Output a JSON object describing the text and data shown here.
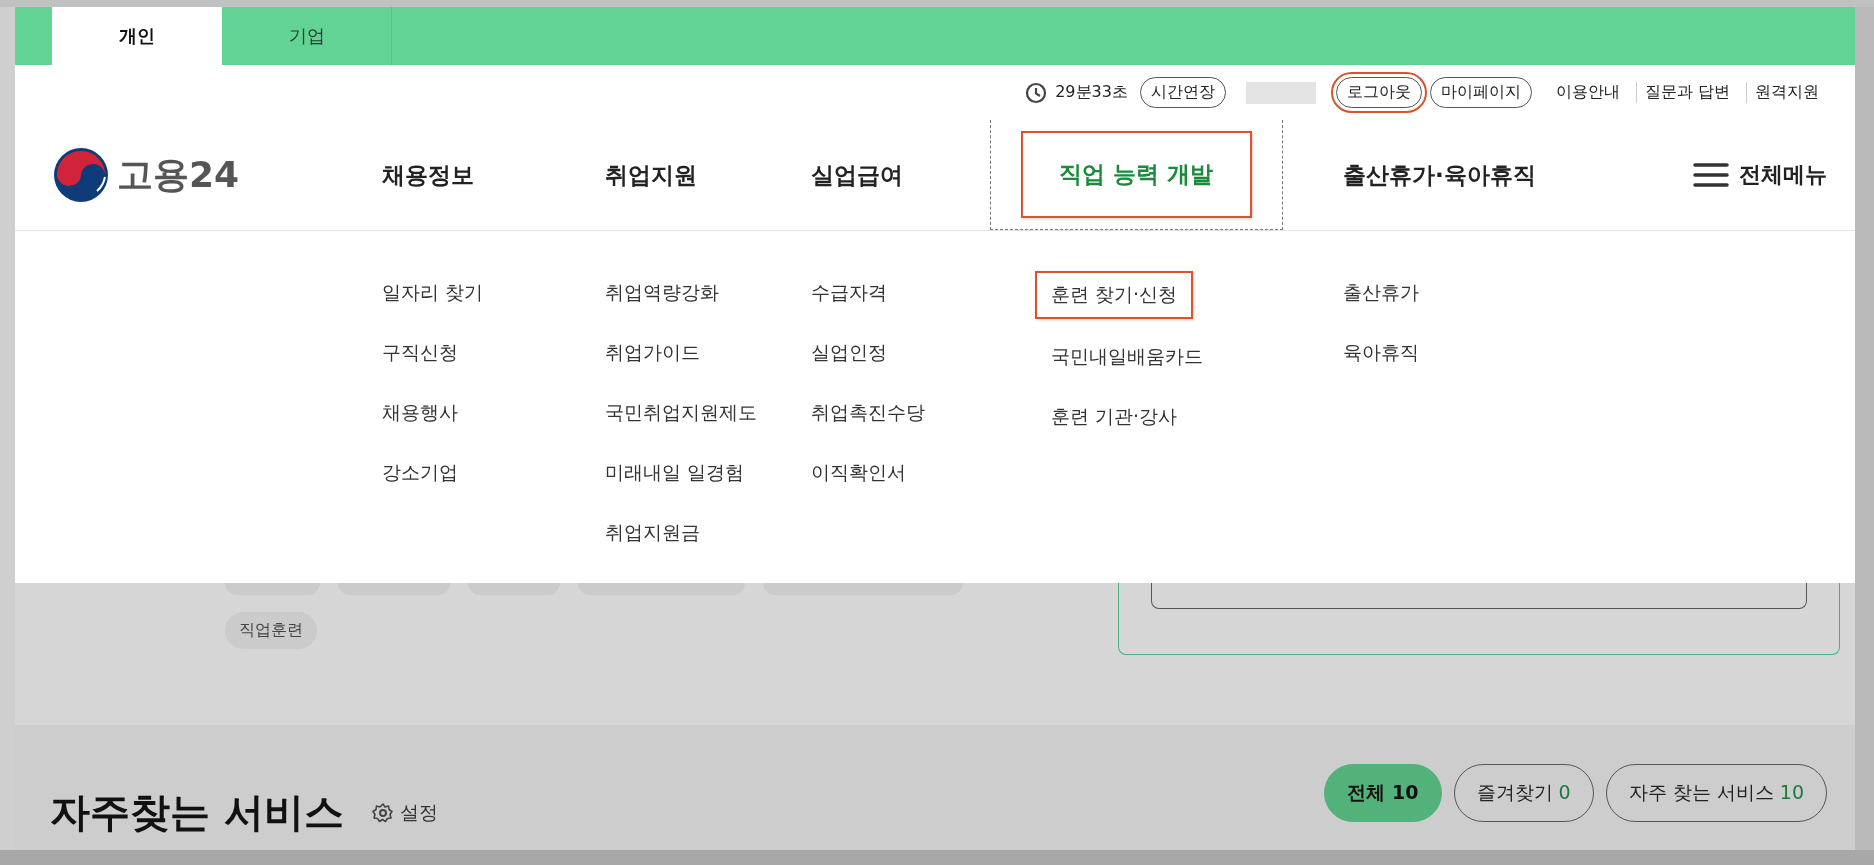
{
  "tabs": [
    {
      "label": "개인",
      "selected": true
    },
    {
      "label": "기업",
      "selected": false
    }
  ],
  "utility": {
    "timer": "29분33초",
    "extend_button": "시간연장",
    "logout_button": {
      "label": "로그아웃",
      "highlighted": true
    },
    "mypage_button": "마이페이지",
    "links": [
      "이용안내",
      "질문과 답변",
      "원격지원"
    ]
  },
  "logo": {
    "text": "고용24"
  },
  "nav": [
    {
      "label": "채용정보",
      "selected": false,
      "submenu": [
        {
          "label": "일자리 찾기",
          "highlighted": false
        },
        {
          "label": "구직신청",
          "highlighted": false
        },
        {
          "label": "채용행사",
          "highlighted": false
        },
        {
          "label": "강소기업",
          "highlighted": false
        }
      ]
    },
    {
      "label": "취업지원",
      "selected": false,
      "submenu": [
        {
          "label": "취업역량강화",
          "highlighted": false
        },
        {
          "label": "취업가이드",
          "highlighted": false
        },
        {
          "label": "국민취업지원제도",
          "highlighted": false
        },
        {
          "label": "미래내일 일경험",
          "highlighted": false
        },
        {
          "label": "취업지원금",
          "highlighted": false
        }
      ]
    },
    {
      "label": "실업급여",
      "selected": false,
      "submenu": [
        {
          "label": "수급자격",
          "highlighted": false
        },
        {
          "label": "실업인정",
          "highlighted": false
        },
        {
          "label": "취업촉진수당",
          "highlighted": false
        },
        {
          "label": "이직확인서",
          "highlighted": false
        }
      ]
    },
    {
      "label": "직업 능력 개발",
      "selected": true,
      "submenu": [
        {
          "label": "훈련 찾기·신청",
          "highlighted": true
        },
        {
          "label": "국민내일배움카드",
          "highlighted": false
        },
        {
          "label": "훈련 기관·강사",
          "highlighted": false
        }
      ]
    },
    {
      "label": "출산휴가·육아휴직",
      "selected": false,
      "submenu": [
        {
          "label": "출산휴가",
          "highlighted": false
        },
        {
          "label": "육아휴직",
          "highlighted": false
        }
      ]
    }
  ],
  "all_menu": "전체메뉴",
  "background": {
    "chip": "직업훈련",
    "section_title": "자주찾는 서비스",
    "settings": "설정",
    "filters": [
      {
        "label": "전체",
        "count": "10",
        "selected": true
      },
      {
        "label": "즐겨찾기",
        "count": "0",
        "selected": false
      },
      {
        "label": "자주 찾는 서비스",
        "count": "10",
        "selected": false
      }
    ]
  }
}
